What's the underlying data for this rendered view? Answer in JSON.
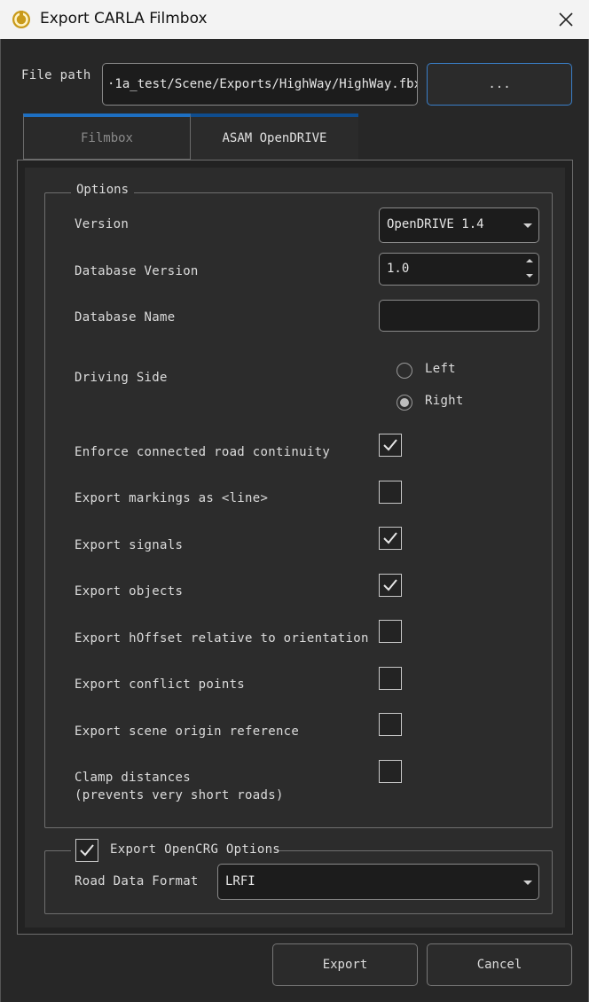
{
  "window": {
    "title": "Export CARLA Filmbox"
  },
  "file_path": {
    "label": "File path",
    "value": "·1a_test/Scene/Exports/HighWay/HighWay.fbx",
    "browse_label": "..."
  },
  "tabs": [
    {
      "label": "Filmbox",
      "active": false
    },
    {
      "label": "ASAM OpenDRIVE",
      "active": true
    }
  ],
  "options": {
    "group_title": "Options",
    "version": {
      "label": "Version",
      "value": "OpenDRIVE 1.4"
    },
    "database_version": {
      "label": "Database Version",
      "value": "1.0"
    },
    "database_name": {
      "label": "Database Name",
      "value": ""
    },
    "driving_side": {
      "label": "Driving Side",
      "options": [
        {
          "label": "Left",
          "selected": false
        },
        {
          "label": "Right",
          "selected": true
        }
      ]
    },
    "checkboxes": [
      {
        "label": "Enforce connected road continuity",
        "checked": true
      },
      {
        "label": "Export markings as <line>",
        "checked": false
      },
      {
        "label": "Export signals",
        "checked": true
      },
      {
        "label": "Export objects",
        "checked": true
      },
      {
        "label": "Export hOffset relative to orientation",
        "checked": false
      },
      {
        "label": "Export conflict points",
        "checked": false
      },
      {
        "label": "Export scene origin reference",
        "checked": false
      },
      {
        "label": "Clamp distances",
        "label2": "(prevents very short roads)",
        "checked": false
      }
    ]
  },
  "opencrg": {
    "title": "Export OpenCRG Options",
    "checked": true,
    "road_data_format": {
      "label": "Road Data Format",
      "value": "LRFI"
    }
  },
  "footer": {
    "export_label": "Export",
    "cancel_label": "Cancel"
  },
  "colors": {
    "accent": "#1d6fc2",
    "background": "#272727",
    "titlebar": "#f3f3f3"
  },
  "icons": {
    "app": "carla-logo-icon",
    "close": "close-icon",
    "check": "checkmark-icon"
  }
}
